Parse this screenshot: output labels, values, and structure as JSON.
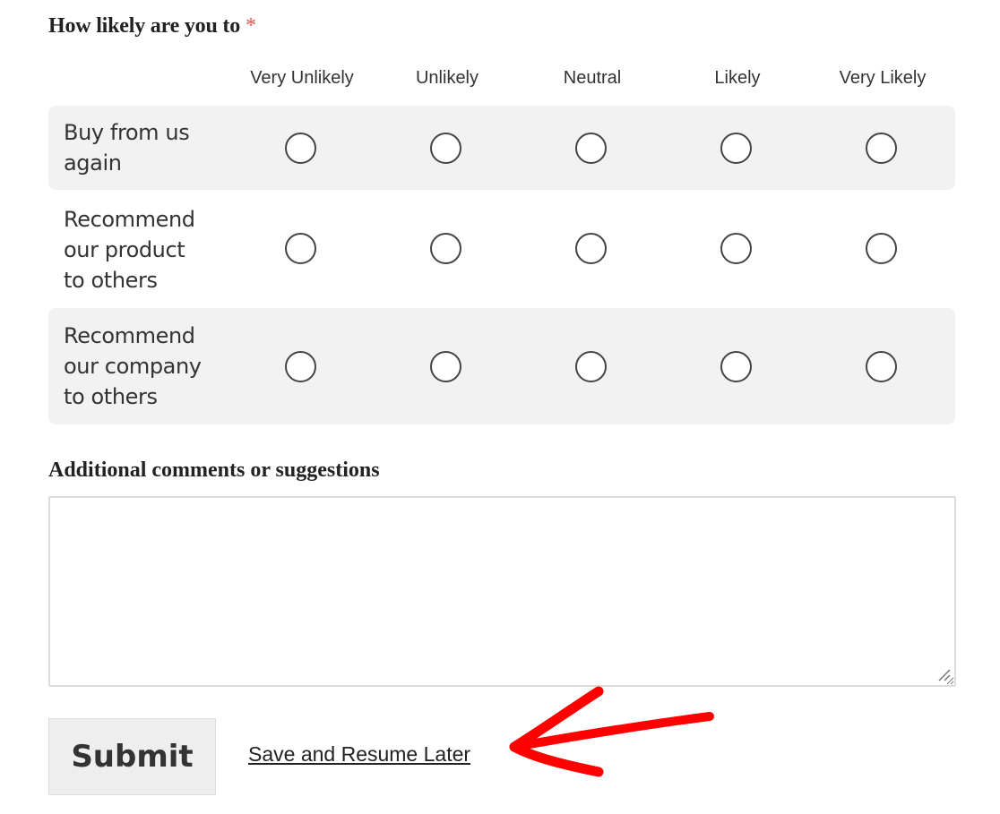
{
  "question": {
    "label": "How likely are you to",
    "required_marker": "*"
  },
  "columns": [
    {
      "label": "Very Unlikely"
    },
    {
      "label": "Unlikely"
    },
    {
      "label": "Neutral"
    },
    {
      "label": "Likely"
    },
    {
      "label": "Very Likely"
    }
  ],
  "rows": [
    {
      "label_lines": [
        "Buy from us",
        "again"
      ],
      "selected": null
    },
    {
      "label_lines": [
        "Recommend",
        "our product",
        "to others"
      ],
      "selected": null
    },
    {
      "label_lines": [
        "Recommend",
        "our company",
        "to others"
      ],
      "selected": null
    }
  ],
  "comments": {
    "label": "Additional comments or suggestions",
    "value": "",
    "placeholder": ""
  },
  "actions": {
    "submit_label": "Submit",
    "save_resume_label": "Save and Resume Later"
  },
  "annotation": {
    "type": "red-arrow",
    "points_to": "save-and-resume-link",
    "color": "#ff0000"
  }
}
